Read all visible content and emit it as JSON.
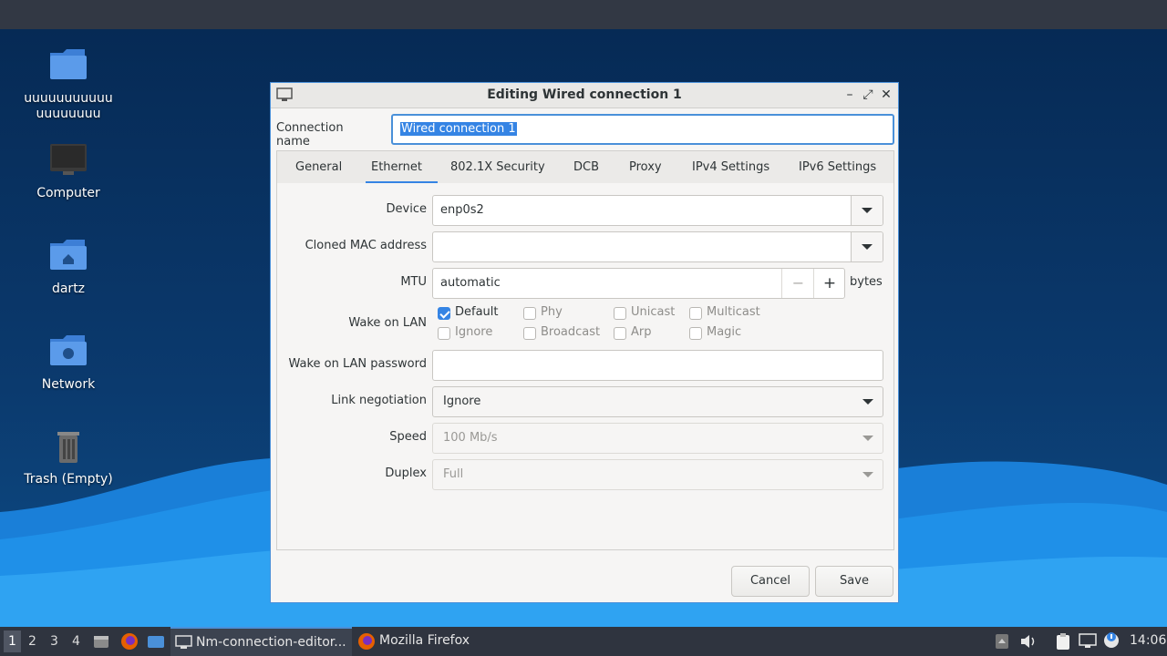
{
  "desktop_icons": [
    {
      "name": "folder-icon",
      "label": "uuuuuuuuuuuuuuuuuuu"
    },
    {
      "name": "computer-icon",
      "label": "Computer"
    },
    {
      "name": "home-folder-icon",
      "label": "dartz"
    },
    {
      "name": "network-folder-icon",
      "label": "Network"
    },
    {
      "name": "trash-icon",
      "label": "Trash (Empty)"
    }
  ],
  "dialog": {
    "title": "Editing Wired connection 1",
    "connection_name_label": "Connection name",
    "connection_name_value": "Wired connection 1",
    "tabs": [
      "General",
      "Ethernet",
      "802.1X Security",
      "DCB",
      "Proxy",
      "IPv4 Settings",
      "IPv6 Settings"
    ],
    "active_tab": "Ethernet",
    "device_label": "Device",
    "device_value": "enp0s2",
    "cloned_mac_label": "Cloned MAC address",
    "cloned_mac_value": "",
    "mtu_label": "MTU",
    "mtu_value": "automatic",
    "mtu_minus": "−",
    "mtu_plus": "+",
    "mtu_unit": "bytes",
    "wol_label": "Wake on LAN",
    "wol_options": [
      {
        "label": "Default",
        "checked": true
      },
      {
        "label": "Phy",
        "checked": false
      },
      {
        "label": "Unicast",
        "checked": false
      },
      {
        "label": "Multicast",
        "checked": false
      },
      {
        "label": "Ignore",
        "checked": false
      },
      {
        "label": "Broadcast",
        "checked": false
      },
      {
        "label": "Arp",
        "checked": false
      },
      {
        "label": "Magic",
        "checked": false
      }
    ],
    "wol_password_label": "Wake on LAN password",
    "wol_password_value": "",
    "link_negotiation_label": "Link negotiation",
    "link_negotiation_value": "Ignore",
    "speed_label": "Speed",
    "speed_value": "100 Mb/s",
    "duplex_label": "Duplex",
    "duplex_value": "Full",
    "cancel_label": "Cancel",
    "save_label": "Save"
  },
  "taskbar": {
    "workspaces": [
      "1",
      "2",
      "3",
      "4"
    ],
    "active_workspace": "1",
    "tasks": [
      {
        "label": "Nm-connection-editor...",
        "active": true
      },
      {
        "label": "Mozilla Firefox",
        "active": false
      }
    ],
    "clock": "14:06"
  },
  "colors": {
    "accent": "#3584e4",
    "panel": "#2f343f",
    "dialog_bg": "#f6f5f4"
  }
}
